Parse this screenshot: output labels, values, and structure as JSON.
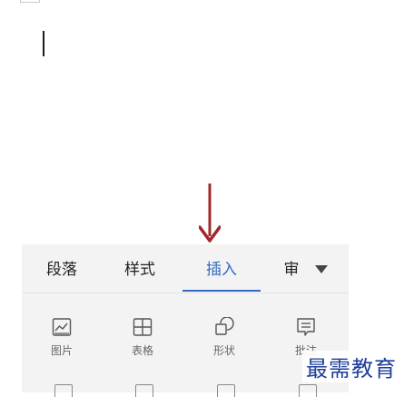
{
  "tabs": [
    {
      "label": "段落",
      "active": false
    },
    {
      "label": "样式",
      "active": false
    },
    {
      "label": "插入",
      "active": true
    },
    {
      "label": "审",
      "active": false
    }
  ],
  "tools": [
    {
      "label": "图片",
      "icon": "image-icon"
    },
    {
      "label": "表格",
      "icon": "table-icon"
    },
    {
      "label": "形状",
      "icon": "shape-icon"
    },
    {
      "label": "批注",
      "icon": "comment-icon"
    }
  ],
  "watermark": "最需教育",
  "colors": {
    "accent": "#2f6ac0",
    "arrow": "#a0282a",
    "panel": "#f3f3f4"
  }
}
